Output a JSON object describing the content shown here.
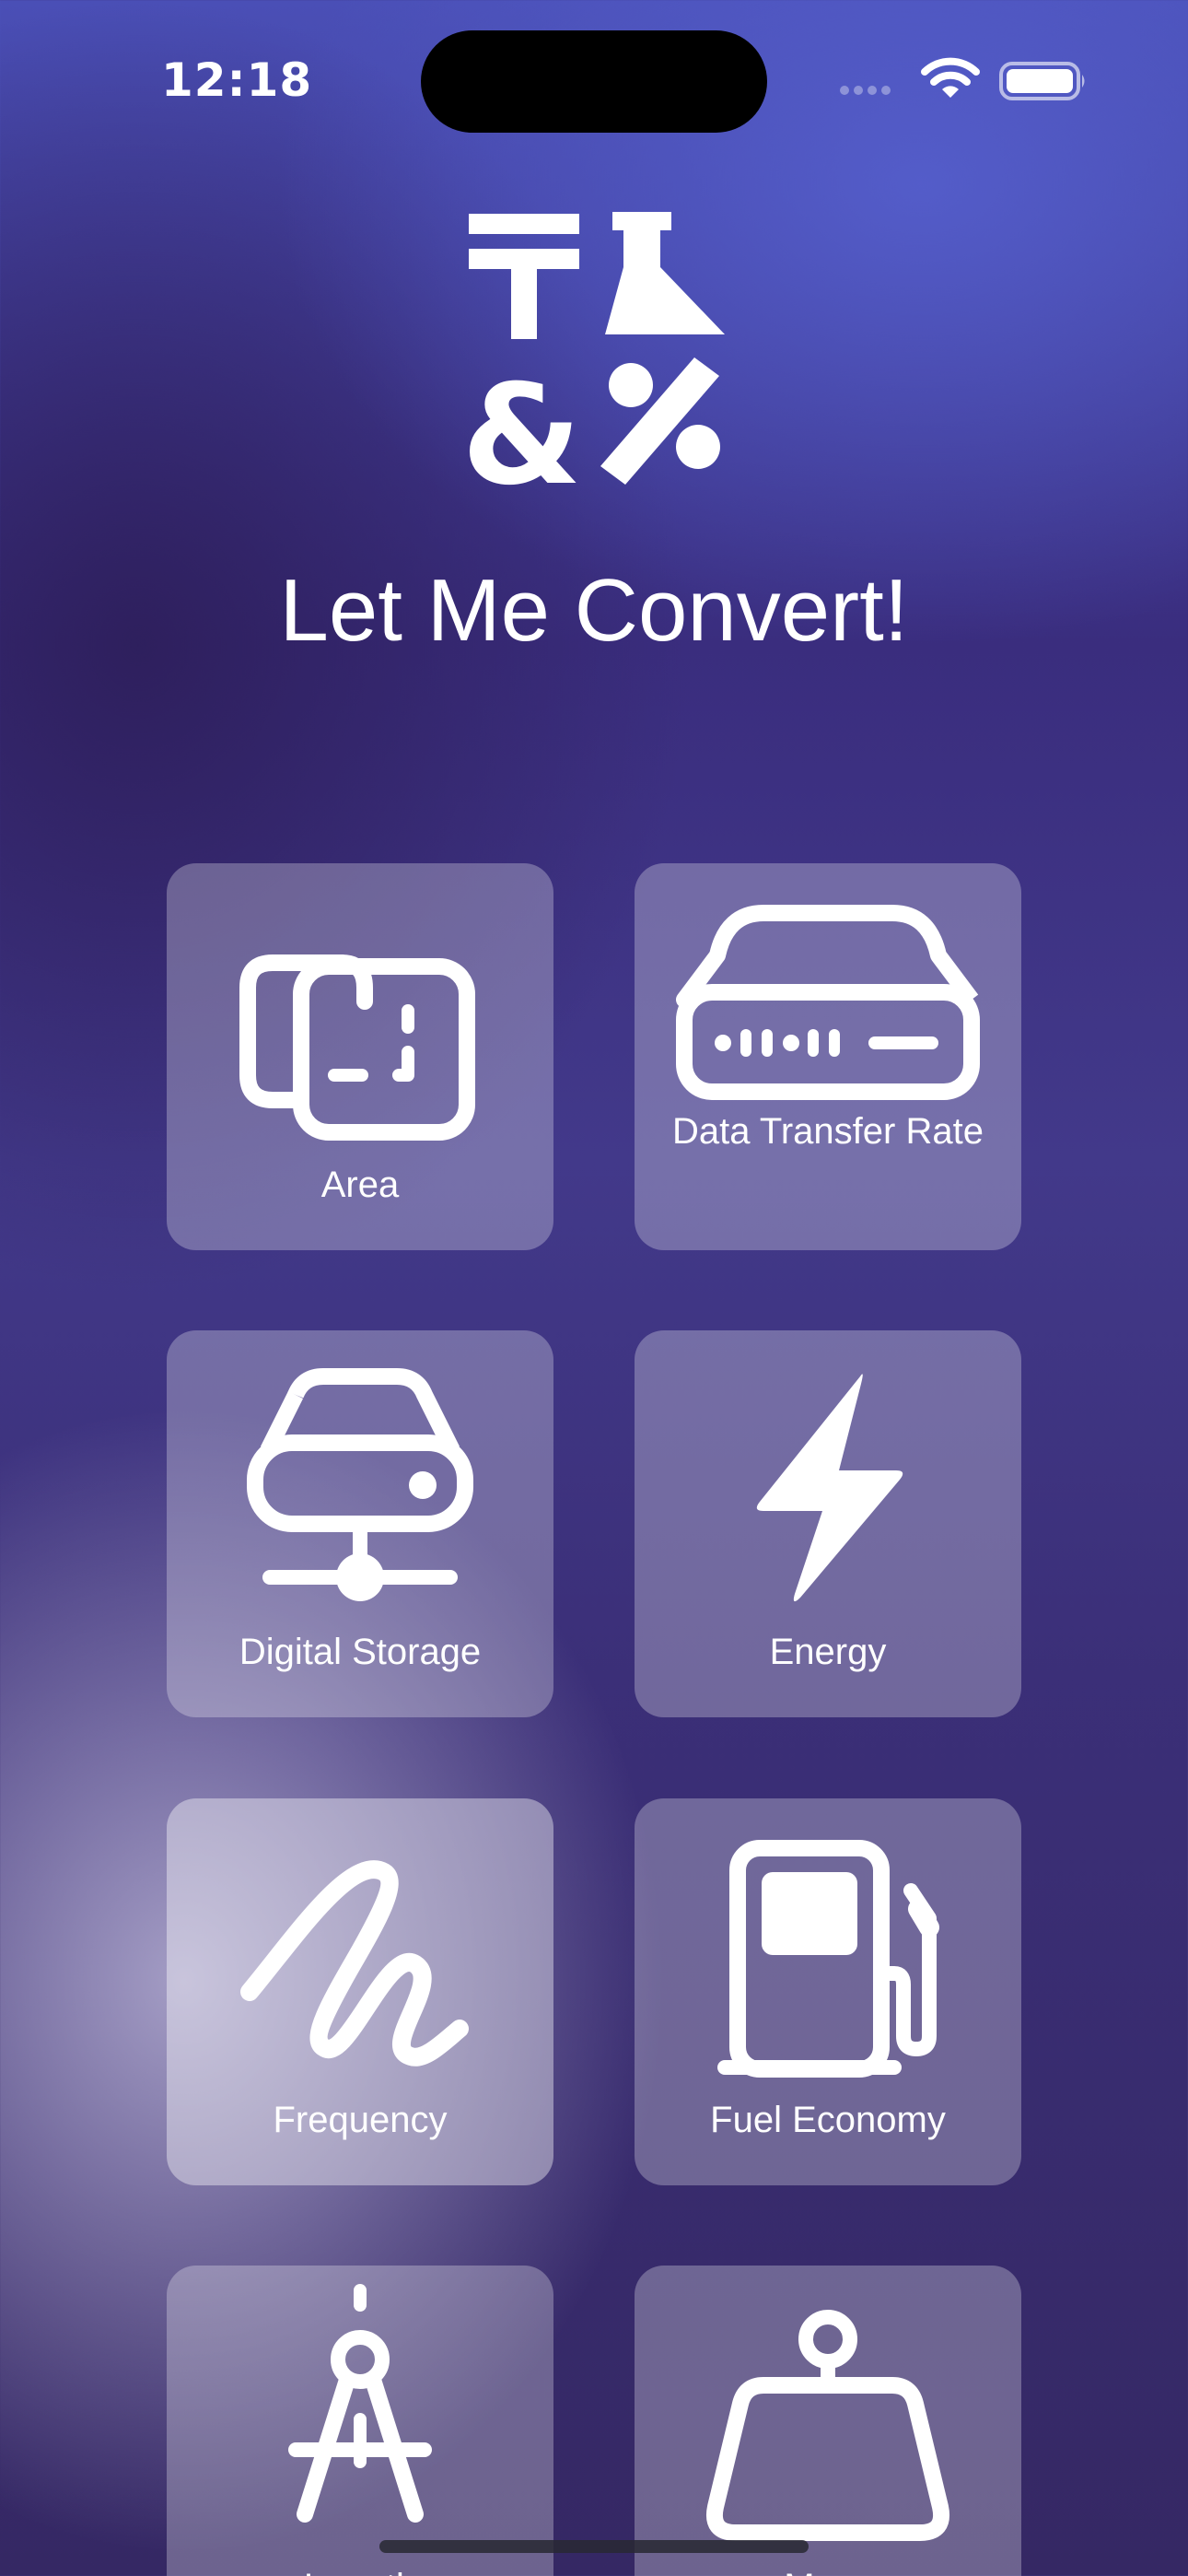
{
  "status_bar": {
    "time": "12:18"
  },
  "app": {
    "title": "Let Me Convert!"
  },
  "tiles": [
    {
      "label": "Area",
      "icon": "area-icon"
    },
    {
      "label": "Data Transfer Rate",
      "icon": "router-icon"
    },
    {
      "label": "Digital Storage",
      "icon": "network-drive-icon"
    },
    {
      "label": "Energy",
      "icon": "bolt-icon"
    },
    {
      "label": "Frequency",
      "icon": "scribble-icon"
    },
    {
      "label": "Fuel Economy",
      "icon": "fuel-pump-icon"
    },
    {
      "label": "Length",
      "icon": "compass-icon"
    },
    {
      "label": "Mass",
      "icon": "scale-weight-icon"
    }
  ]
}
